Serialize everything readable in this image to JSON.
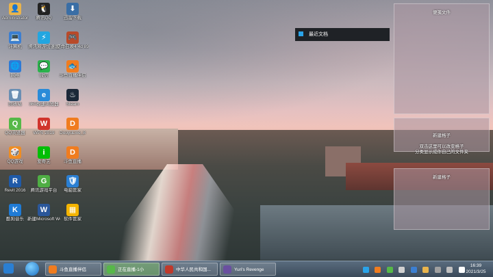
{
  "desktop_icons": [
    {
      "name": "admin-icon",
      "label": "Administrator",
      "color": "#e9b44c",
      "glyph": "👤"
    },
    {
      "name": "qq-icon",
      "label": "腾讯QQ",
      "color": "#222",
      "glyph": "🐧"
    },
    {
      "name": "download-icon",
      "label": "迅雷下载",
      "color": "#3a6ea5",
      "glyph": "⬇"
    },
    {
      "name": "computer-icon",
      "label": "计算机",
      "color": "#3c7fd1",
      "glyph": "💻"
    },
    {
      "name": "taskbar-icon",
      "label": "腾讯网游加速器",
      "color": "#23a6e0",
      "glyph": "⚡"
    },
    {
      "name": "game-icon",
      "label": "使命召唤4 4d 89",
      "color": "#b84a2a",
      "glyph": "🎮"
    },
    {
      "name": "network-icon",
      "label": "网络",
      "color": "#2d7bd6",
      "glyph": "🌐"
    },
    {
      "name": "wechat-icon",
      "label": "微信",
      "color": "#2bb24c",
      "glyph": "💬"
    },
    {
      "name": "douyu-icon",
      "label": "斗鱼直播伴侣",
      "color": "#f07c1f",
      "glyph": "🐟"
    },
    {
      "name": "recycle-bin-icon",
      "label": "回收站",
      "color": "#6a8fb3",
      "glyph": "🗑"
    },
    {
      "name": "ie-icon",
      "label": "360极速浏览器",
      "color": "#2a8bd8",
      "glyph": "e"
    },
    {
      "name": "steam-icon",
      "label": "Steam",
      "color": "#1b2838",
      "glyph": "♨"
    },
    {
      "name": "qq-browser-icon",
      "label": "QQ浏览器",
      "color": "#56b848",
      "glyph": "Q"
    },
    {
      "name": "wps-icon",
      "label": "WPS 2019",
      "color": "#d0342c",
      "glyph": "W"
    },
    {
      "name": "douyu-live-icon",
      "label": "DouyuLive_8",
      "color": "#f07c1f",
      "glyph": "D"
    },
    {
      "name": "qq-game-icon",
      "label": "QQ游戏",
      "color": "#ef8d22",
      "glyph": "🎲"
    },
    {
      "name": "iqiyi-icon",
      "label": "爱奇艺",
      "color": "#00be06",
      "glyph": "i"
    },
    {
      "name": "douyu-live2-icon",
      "label": "斗鱼直播",
      "color": "#f07c1f",
      "glyph": "D"
    },
    {
      "name": "revit-icon",
      "label": "Revit 2016",
      "color": "#1f5aa8",
      "glyph": "R"
    },
    {
      "name": "game-center-icon",
      "label": "腾讯游戏平台",
      "color": "#4fae44",
      "glyph": "G"
    },
    {
      "name": "pc-manager-icon",
      "label": "电脑管家",
      "color": "#2a7fd3",
      "glyph": "🛡"
    },
    {
      "name": "steam-game-icon",
      "label": "酷狗音乐",
      "color": "#1f7bd6",
      "glyph": "K"
    },
    {
      "name": "word-icon",
      "label": "新建Microsoft Word",
      "color": "#2b579a",
      "glyph": "W"
    },
    {
      "name": "software-manager-icon",
      "label": "软件管家",
      "color": "#f4b400",
      "glyph": "▦"
    }
  ],
  "recent_docs_label": "最近文档",
  "gadgets": [
    {
      "title": "便笺文件"
    },
    {
      "title": "新建格子\n\n双击这里可以改变格子\n分类显示成你自己的文件夹"
    },
    {
      "title": "新建格子"
    }
  ],
  "taskbar": {
    "buttons": [
      {
        "label": "斗鱼直播伴侣",
        "color": "#f07c1f"
      },
      {
        "label": "正在直播-1小",
        "color": "#56b848"
      },
      {
        "label": "中华人民共和国...",
        "color": "#c0392b"
      },
      {
        "label": "Yuri's Revenge",
        "color": "#6a4fa0"
      }
    ],
    "clock_time": "16:39",
    "clock_date": "2021/3/25"
  }
}
